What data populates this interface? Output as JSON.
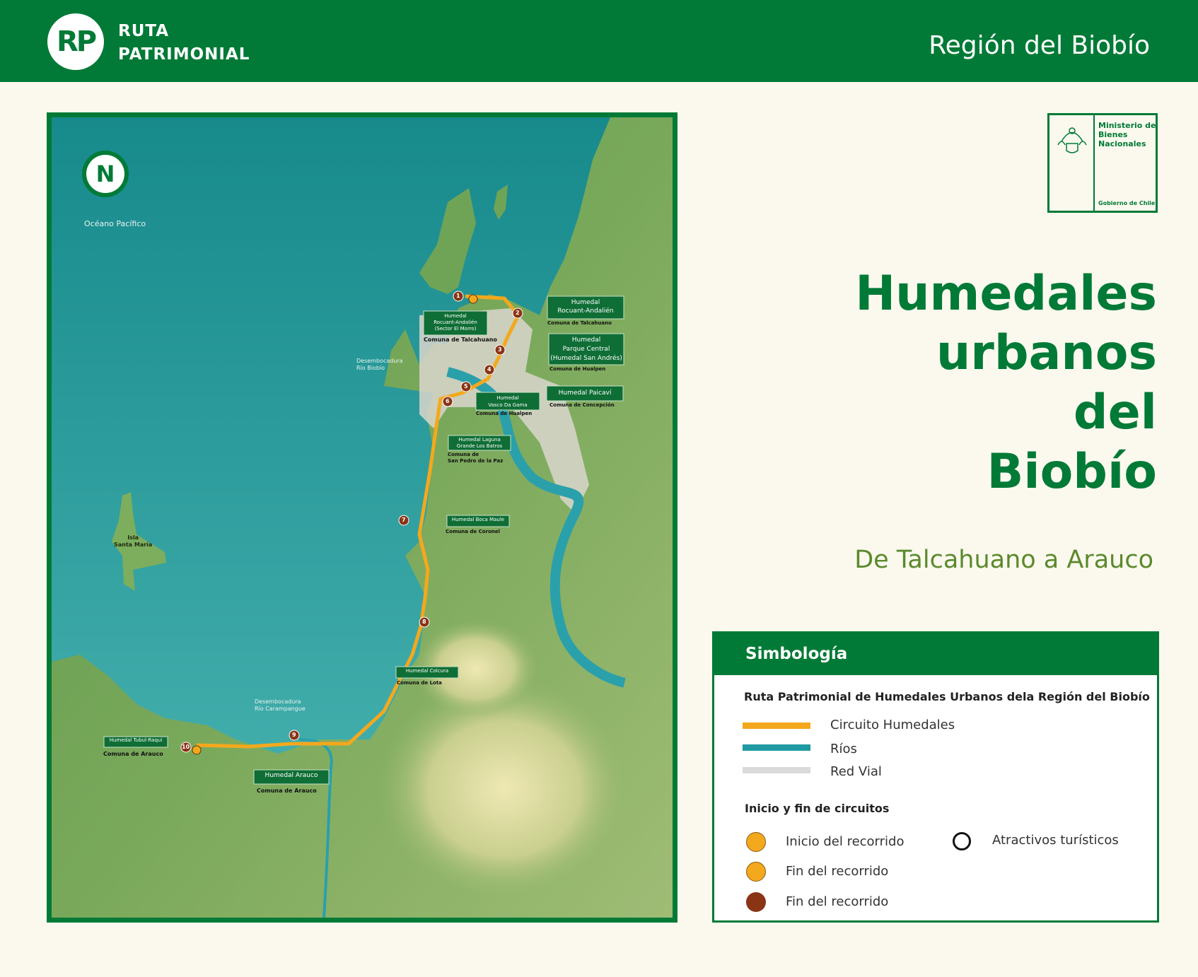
{
  "header": {
    "logo_initials": "RP",
    "logo_line1": "RUTA",
    "logo_line2": "PATRIMONIAL",
    "region": "Región del Biobío"
  },
  "ministry": {
    "name": "Ministerio de Bienes Nacionales",
    "government": "Gobierno de Chile"
  },
  "title": {
    "line1": "Humedales",
    "line2": "urbanos",
    "line3": "del",
    "line4": "Biobío",
    "subtitle": "De Talcahuano a Arauco"
  },
  "map": {
    "north": "N",
    "ocean": "Océano Pacífico",
    "island_line1": "Isla",
    "island_line2": "Santa María",
    "river_mouth_biobio_1": "Desembocadura",
    "river_mouth_biobio_2": "Río Biobío",
    "river_mouth_carampangue_1": "Desembocadura",
    "river_mouth_carampangue_2": "Río Carampangue",
    "sites": [
      {
        "num": "1",
        "name_lines": [
          "Humedal",
          "Rocuant-Andalién",
          "(Sector El Morro)"
        ],
        "commune": "Comuna de Talcahuano"
      },
      {
        "num": "2",
        "name_lines": [
          "Humedal",
          "Rocuant-Andalién"
        ],
        "commune": "Comuna de Talcahuano"
      },
      {
        "num": "3",
        "name_lines": [
          "Humedal",
          "Parque Central",
          "(Humedal San Andrés)"
        ],
        "commune": "Comuna de Hualpen"
      },
      {
        "num": "4",
        "name_lines": [
          "Humedal Paicaví"
        ],
        "commune": "Comuna de Concepción"
      },
      {
        "num": "5",
        "name_lines": [
          "Humedal",
          "Vasco Da Gama"
        ],
        "commune": "Comuna de Hualpen"
      },
      {
        "num": "6",
        "name_lines": [
          "Humedal Laguna",
          "Grande Los Batros"
        ],
        "commune_lines": [
          "Comuna de",
          "San Pedro de la Paz"
        ]
      },
      {
        "num": "7",
        "name_lines": [
          "Humedal Boca Maule"
        ],
        "commune": "Comuna de Coronel"
      },
      {
        "num": "8",
        "name_lines": [
          "Humedal  Colcura"
        ],
        "commune": "Comuna de Lota"
      },
      {
        "num": "9",
        "name_lines": [
          "Humedal Arauco"
        ],
        "commune": "Comuna de Arauco"
      },
      {
        "num": "10",
        "name_lines": [
          "Humedal Tubul-Raqui"
        ],
        "commune": "Comuna de Arauco"
      }
    ]
  },
  "legend": {
    "title": "Simbología",
    "route_heading": "Ruta Patrimonial de Humedales Urbanos dela Región del Biobío",
    "lines": [
      {
        "label": "Circuito Humedales",
        "color": "#f4a81d"
      },
      {
        "label": "Ríos",
        "color": "#1f9aa3"
      },
      {
        "label": "Red Vial",
        "color": "#dadada"
      }
    ],
    "points_heading": "Inicio y fin de circuitos",
    "start": "Inicio del recorrido",
    "end_1": "Fin del recorrido",
    "end_2": "Fin del recorrido",
    "attractions": "Atractivos turísticos",
    "colors": {
      "start": "#f4a81d",
      "end_orange": "#f4a81d",
      "end_brown": "#8a3416",
      "attraction": "#ffffff"
    }
  }
}
